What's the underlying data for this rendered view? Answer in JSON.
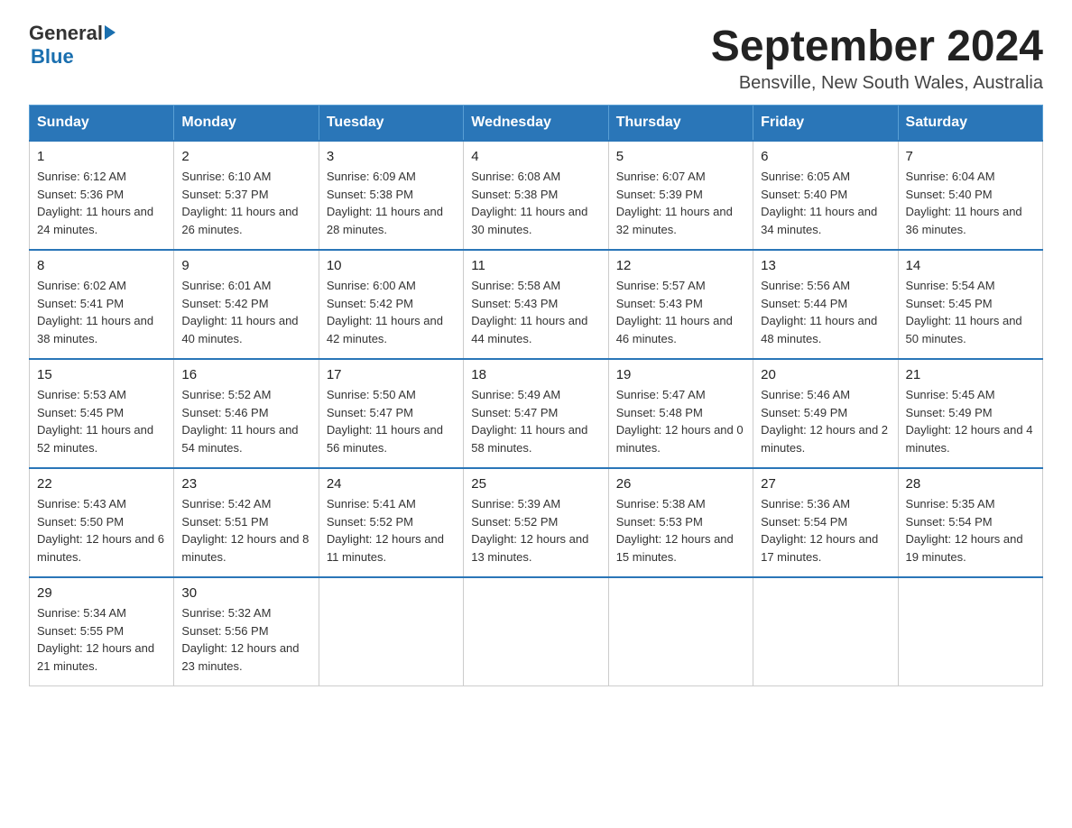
{
  "logo": {
    "text_general": "General",
    "text_blue": "Blue",
    "arrow": "▶"
  },
  "title": "September 2024",
  "location": "Bensville, New South Wales, Australia",
  "days_of_week": [
    "Sunday",
    "Monday",
    "Tuesday",
    "Wednesday",
    "Thursday",
    "Friday",
    "Saturday"
  ],
  "weeks": [
    [
      {
        "day": "1",
        "sunrise": "6:12 AM",
        "sunset": "5:36 PM",
        "daylight": "11 hours and 24 minutes."
      },
      {
        "day": "2",
        "sunrise": "6:10 AM",
        "sunset": "5:37 PM",
        "daylight": "11 hours and 26 minutes."
      },
      {
        "day": "3",
        "sunrise": "6:09 AM",
        "sunset": "5:38 PM",
        "daylight": "11 hours and 28 minutes."
      },
      {
        "day": "4",
        "sunrise": "6:08 AM",
        "sunset": "5:38 PM",
        "daylight": "11 hours and 30 minutes."
      },
      {
        "day": "5",
        "sunrise": "6:07 AM",
        "sunset": "5:39 PM",
        "daylight": "11 hours and 32 minutes."
      },
      {
        "day": "6",
        "sunrise": "6:05 AM",
        "sunset": "5:40 PM",
        "daylight": "11 hours and 34 minutes."
      },
      {
        "day": "7",
        "sunrise": "6:04 AM",
        "sunset": "5:40 PM",
        "daylight": "11 hours and 36 minutes."
      }
    ],
    [
      {
        "day": "8",
        "sunrise": "6:02 AM",
        "sunset": "5:41 PM",
        "daylight": "11 hours and 38 minutes."
      },
      {
        "day": "9",
        "sunrise": "6:01 AM",
        "sunset": "5:42 PM",
        "daylight": "11 hours and 40 minutes."
      },
      {
        "day": "10",
        "sunrise": "6:00 AM",
        "sunset": "5:42 PM",
        "daylight": "11 hours and 42 minutes."
      },
      {
        "day": "11",
        "sunrise": "5:58 AM",
        "sunset": "5:43 PM",
        "daylight": "11 hours and 44 minutes."
      },
      {
        "day": "12",
        "sunrise": "5:57 AM",
        "sunset": "5:43 PM",
        "daylight": "11 hours and 46 minutes."
      },
      {
        "day": "13",
        "sunrise": "5:56 AM",
        "sunset": "5:44 PM",
        "daylight": "11 hours and 48 minutes."
      },
      {
        "day": "14",
        "sunrise": "5:54 AM",
        "sunset": "5:45 PM",
        "daylight": "11 hours and 50 minutes."
      }
    ],
    [
      {
        "day": "15",
        "sunrise": "5:53 AM",
        "sunset": "5:45 PM",
        "daylight": "11 hours and 52 minutes."
      },
      {
        "day": "16",
        "sunrise": "5:52 AM",
        "sunset": "5:46 PM",
        "daylight": "11 hours and 54 minutes."
      },
      {
        "day": "17",
        "sunrise": "5:50 AM",
        "sunset": "5:47 PM",
        "daylight": "11 hours and 56 minutes."
      },
      {
        "day": "18",
        "sunrise": "5:49 AM",
        "sunset": "5:47 PM",
        "daylight": "11 hours and 58 minutes."
      },
      {
        "day": "19",
        "sunrise": "5:47 AM",
        "sunset": "5:48 PM",
        "daylight": "12 hours and 0 minutes."
      },
      {
        "day": "20",
        "sunrise": "5:46 AM",
        "sunset": "5:49 PM",
        "daylight": "12 hours and 2 minutes."
      },
      {
        "day": "21",
        "sunrise": "5:45 AM",
        "sunset": "5:49 PM",
        "daylight": "12 hours and 4 minutes."
      }
    ],
    [
      {
        "day": "22",
        "sunrise": "5:43 AM",
        "sunset": "5:50 PM",
        "daylight": "12 hours and 6 minutes."
      },
      {
        "day": "23",
        "sunrise": "5:42 AM",
        "sunset": "5:51 PM",
        "daylight": "12 hours and 8 minutes."
      },
      {
        "day": "24",
        "sunrise": "5:41 AM",
        "sunset": "5:52 PM",
        "daylight": "12 hours and 11 minutes."
      },
      {
        "day": "25",
        "sunrise": "5:39 AM",
        "sunset": "5:52 PM",
        "daylight": "12 hours and 13 minutes."
      },
      {
        "day": "26",
        "sunrise": "5:38 AM",
        "sunset": "5:53 PM",
        "daylight": "12 hours and 15 minutes."
      },
      {
        "day": "27",
        "sunrise": "5:36 AM",
        "sunset": "5:54 PM",
        "daylight": "12 hours and 17 minutes."
      },
      {
        "day": "28",
        "sunrise": "5:35 AM",
        "sunset": "5:54 PM",
        "daylight": "12 hours and 19 minutes."
      }
    ],
    [
      {
        "day": "29",
        "sunrise": "5:34 AM",
        "sunset": "5:55 PM",
        "daylight": "12 hours and 21 minutes."
      },
      {
        "day": "30",
        "sunrise": "5:32 AM",
        "sunset": "5:56 PM",
        "daylight": "12 hours and 23 minutes."
      },
      null,
      null,
      null,
      null,
      null
    ]
  ],
  "labels": {
    "sunrise": "Sunrise: ",
    "sunset": "Sunset: ",
    "daylight": "Daylight: "
  }
}
